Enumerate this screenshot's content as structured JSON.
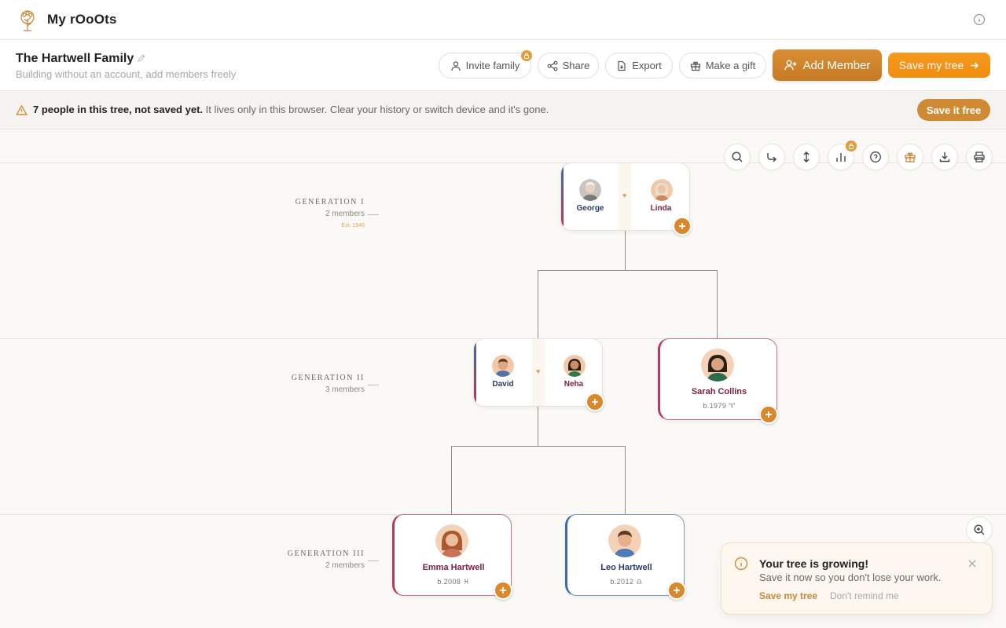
{
  "app": {
    "brand": "My rOoOts"
  },
  "header": {
    "family_title": "The Hartwell Family",
    "subtitle": "Building without an account, add members freely",
    "buttons": {
      "invite": "Invite family",
      "share": "Share",
      "export": "Export",
      "gift": "Make a gift",
      "add_member": "Add Member",
      "save_tree": "Save my tree"
    }
  },
  "warning": {
    "bold": "7 people in this tree, not saved yet.",
    "text": " It lives only in this browser. Clear your history or switch device and it's gone.",
    "button": "Save it free"
  },
  "generations": [
    {
      "name": "GENERATION I",
      "count": "2 members",
      "est": "Est. 1946"
    },
    {
      "name": "GENERATION II",
      "count": "3 members"
    },
    {
      "name": "GENERATION III",
      "count": "2 members"
    }
  ],
  "people": {
    "george": {
      "name": "George"
    },
    "linda": {
      "name": "Linda"
    },
    "david": {
      "name": "David"
    },
    "neha": {
      "name": "Neha"
    },
    "sarah": {
      "name": "Sarah Collins",
      "birth": "b.1979 ♈"
    },
    "emma": {
      "name": "Emma Hartwell",
      "birth": "b.2008 ♓"
    },
    "leo": {
      "name": "Leo Hartwell",
      "birth": "b.2012 ♎"
    }
  },
  "colors": {
    "accent": "#d8892c",
    "male": "#3d6aa8",
    "female": "#b8375a",
    "male_text": "#2b3d63",
    "female_text": "#7a2146"
  },
  "toast": {
    "title": "Your tree is growing!",
    "subtitle": "Save it now so you don't lose your work.",
    "save": "Save my tree",
    "dismiss": "Don't remind me"
  }
}
